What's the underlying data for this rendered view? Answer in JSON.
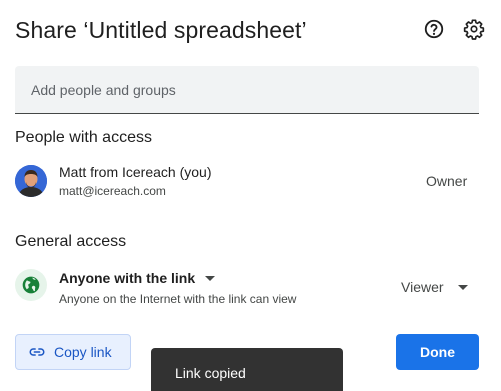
{
  "dialog": {
    "title": "Share ‘Untitled spreadsheet’",
    "help_icon": "help-circle-icon",
    "settings_icon": "gear-icon"
  },
  "add_people": {
    "placeholder": "Add people and groups",
    "value": ""
  },
  "people_section": {
    "heading": "People with access",
    "people": [
      {
        "name": "Matt from Icereach (you)",
        "email": "matt@icereach.com",
        "role": "Owner"
      }
    ]
  },
  "general_access": {
    "heading": "General access",
    "scope_label": "Anyone with the link",
    "description": "Anyone on the Internet with the link can view",
    "role": "Viewer",
    "icon": "globe-icon",
    "icon_color": "#188038"
  },
  "footer": {
    "copy_link_label": "Copy link",
    "done_label": "Done",
    "accent_color": "#1a73e8"
  },
  "toast": {
    "message": "Link copied"
  }
}
